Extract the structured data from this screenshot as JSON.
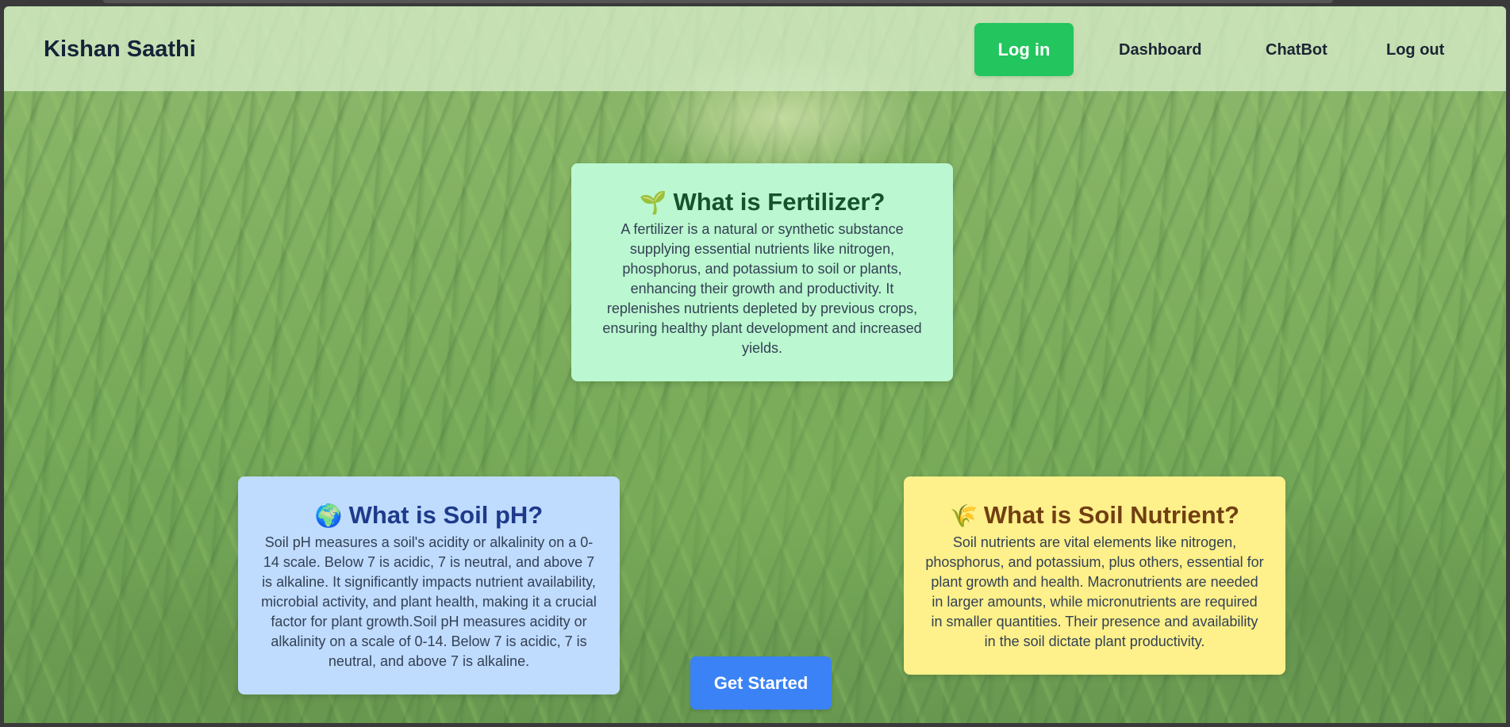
{
  "app": {
    "brand": "Kishan Saathi"
  },
  "nav": {
    "login_label": "Log in",
    "dashboard_label": "Dashboard",
    "chatbot_label": "ChatBot",
    "logout_label": "Log out"
  },
  "cards": {
    "fertilizer": {
      "icon": "seedling-icon",
      "emoji": "🌱",
      "title": "What is Fertilizer?",
      "body": "A fertilizer is a natural or synthetic substance supplying essential nutrients like nitrogen, phosphorus, and potassium to soil or plants, enhancing their growth and productivity. It replenishes nutrients depleted by previous crops, ensuring healthy plant development and increased yields."
    },
    "soil_ph": {
      "icon": "globe-icon",
      "emoji": "🌍",
      "title": "What is Soil pH?",
      "body": "Soil pH measures a soil's acidity or alkalinity on a 0-14 scale. Below 7 is acidic, 7 is neutral, and above 7 is alkaline. It significantly impacts nutrient availability, microbial activity, and plant health, making it a crucial factor for plant growth.Soil pH measures acidity or alkalinity on a scale of 0-14. Below 7 is acidic, 7 is neutral, and above 7 is alkaline."
    },
    "soil_nutrient": {
      "icon": "corn-icon",
      "emoji": "🌾",
      "title": "What is Soil Nutrient?",
      "body": "Soil nutrients are vital elements like nitrogen, phosphorus, and potassium, plus others, essential for plant growth and health. Macronutrients are needed in larger amounts, while micronutrients are required in smaller quantities. Their presence and availability in the soil dictate plant productivity."
    }
  },
  "cta": {
    "get_started_label": "Get Started"
  },
  "colors": {
    "login_button": "#22c55e",
    "cta_button": "#3b82f6",
    "fertilizer_card": "#bbf7d0",
    "ph_card": "#bfdbfe",
    "nutrient_card": "#fef08a"
  }
}
